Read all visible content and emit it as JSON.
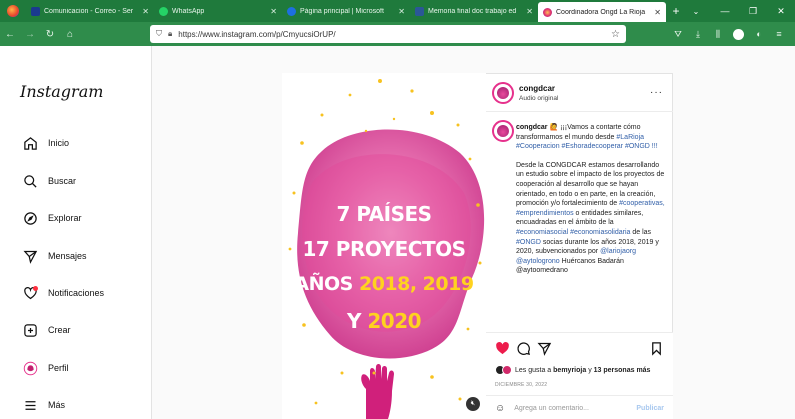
{
  "browser": {
    "tabs": [
      {
        "label": "Comunicacion - Correo - Ser",
        "icon_color": "#1a3a8f",
        "active": false
      },
      {
        "label": "WhatsApp",
        "icon_color": "#25d366",
        "active": false
      },
      {
        "label": "Página principal | Microsoft",
        "icon_color": "#1d6fe0",
        "active": false
      },
      {
        "label": "Memoria final doc trabajo ed",
        "icon_color": "#2b5797",
        "active": false
      },
      {
        "label": "Coordinadora Ongd La Rioja",
        "icon_color": "#e1306c",
        "active": true
      }
    ],
    "new_tab": "+",
    "tab_list": "⌄",
    "url": "https://www.instagram.com/p/CmyucsiOrUP/",
    "window_controls": [
      "—",
      "❐",
      "✕"
    ]
  },
  "sidebar": {
    "logo": "Instagram",
    "items": [
      {
        "label": "Inicio",
        "icon": "home-icon"
      },
      {
        "label": "Buscar",
        "icon": "search-icon"
      },
      {
        "label": "Explorar",
        "icon": "compass-icon"
      },
      {
        "label": "Mensajes",
        "icon": "send-icon"
      },
      {
        "label": "Notificaciones",
        "icon": "heart-icon"
      },
      {
        "label": "Crear",
        "icon": "plus-square-icon"
      },
      {
        "label": "Perfil",
        "icon": "profile-avatar-icon"
      },
      {
        "label": "Más",
        "icon": "menu-icon"
      }
    ]
  },
  "post": {
    "image_lines": [
      {
        "main": "7 PAÍSES",
        "accent": ""
      },
      {
        "main": "17 PROYECTOS",
        "accent": ""
      },
      {
        "main": "AÑOS ",
        "accent": "2018, 2019"
      },
      {
        "main": "Y ",
        "accent": "2020"
      }
    ],
    "username": "congdcar",
    "audio": "Audio original",
    "more": "···",
    "caption_intro": "🙋 ¡¡¡Vamos a contarte cómo transformamos el mundo desde",
    "caption_tags": "#LaRioja #Cooperacion #Eshoradecooperar #ONGD !!!",
    "caption_body_1": "Desde la CONGDCAR estamos desarrollando un estudio sobre el impacto de los proyectos de cooperación al desarrollo que se hayan orientado, en todo o en parte, en la creación, promoción y/o fortalecimiento de",
    "caption_tag_2": "#cooperativas,",
    "caption_tag_3": "#emprendimientos",
    "caption_body_2": "o entidades similares, encuadradas en el ámbito de la",
    "caption_tag_4": "#economiasocial #economiasolidaria",
    "caption_body_3": "de las",
    "caption_tag_5": "#ONGD",
    "caption_body_4": "socias durante los años 2018, 2019 y 2020, subvencionados por",
    "caption_tag_6": "@lariojaorg @aytologrono",
    "caption_body_5": "Huércanos Badarán @aytoomedrano",
    "likes_prefix": "Les gusta a",
    "likes_user": "bemyrioja",
    "likes_mid": "y",
    "likes_count": "13 personas más",
    "date": "DICIEMBRE 30, 2022",
    "comment_placeholder": "Agrega un comentario...",
    "publish": "Publicar"
  }
}
